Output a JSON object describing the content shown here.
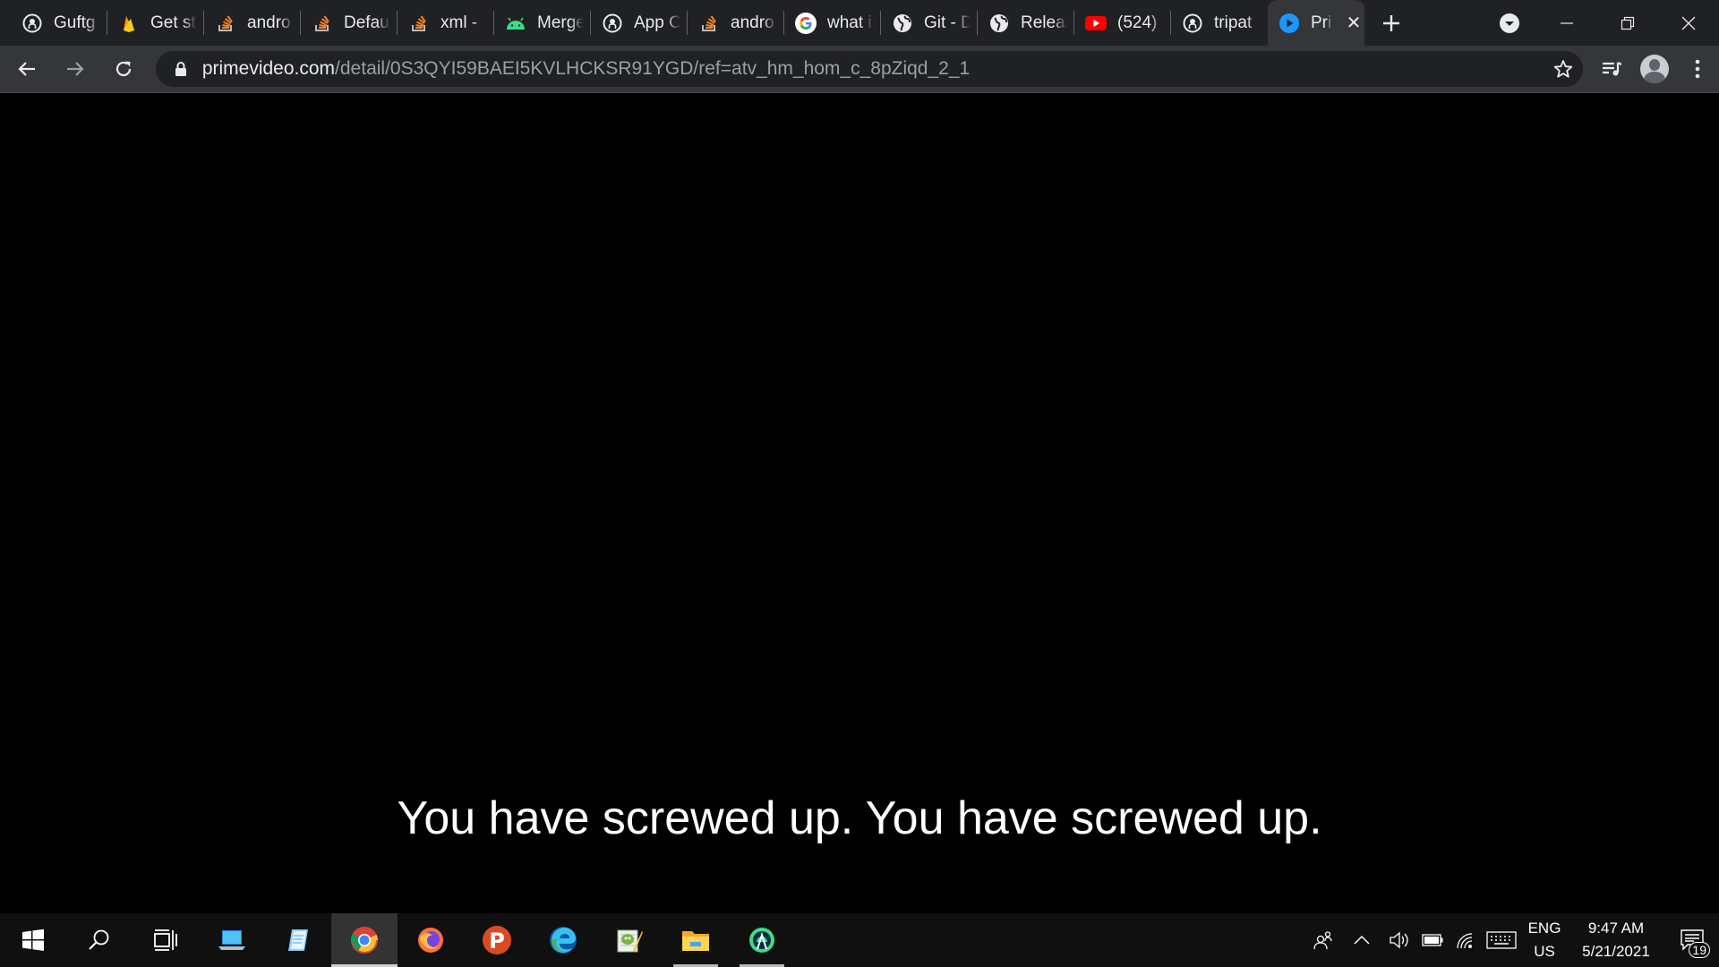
{
  "browser": {
    "tabs": [
      {
        "title": "Guftg",
        "icon": "github-icon"
      },
      {
        "title": "Get st",
        "icon": "firebase-icon"
      },
      {
        "title": "andro",
        "icon": "stackoverflow-icon"
      },
      {
        "title": "Defau",
        "icon": "stackoverflow-icon"
      },
      {
        "title": "xml - ",
        "icon": "stackoverflow-icon"
      },
      {
        "title": "Merge",
        "icon": "android-icon"
      },
      {
        "title": "App C",
        "icon": "github-icon"
      },
      {
        "title": "andro",
        "icon": "stackoverflow-icon"
      },
      {
        "title": "what i",
        "icon": "google-icon"
      },
      {
        "title": "Git - D",
        "icon": "globe-icon"
      },
      {
        "title": "Releas",
        "icon": "globe-icon"
      },
      {
        "title": "(524)",
        "icon": "youtube-icon"
      },
      {
        "title": "tripat",
        "icon": "github-icon"
      },
      {
        "title": "Pri",
        "icon": "primevideo-icon",
        "active": true
      }
    ],
    "url_host": "primevideo.com",
    "url_path": "/detail/0S3QYI59BAEI5KVLHCKSR91YGD/ref=atv_hm_hom_c_8pZiqd_2_1"
  },
  "page": {
    "subtitle": "You have screwed up. You have screwed up."
  },
  "taskbar": {
    "apps": [
      {
        "name": "start-button"
      },
      {
        "name": "search-button"
      },
      {
        "name": "task-view-button"
      },
      {
        "name": "this-pc-app"
      },
      {
        "name": "notepad-app"
      },
      {
        "name": "chrome-app",
        "active": true
      },
      {
        "name": "firefox-app"
      },
      {
        "name": "postman-app"
      },
      {
        "name": "edge-app"
      },
      {
        "name": "notepadpp-app"
      },
      {
        "name": "file-explorer-app",
        "running": true
      },
      {
        "name": "android-studio-app",
        "running": true
      }
    ],
    "language_top": "ENG",
    "language_bottom": "US",
    "time": "9:47 AM",
    "date": "5/21/2021",
    "notification_count": "19"
  },
  "colors": {
    "tabstrip_bg": "#202124",
    "toolbar_bg": "#35363a",
    "page_bg": "#000000",
    "taskbar_bg": "#101010",
    "subtitle_text": "#ffffff"
  }
}
